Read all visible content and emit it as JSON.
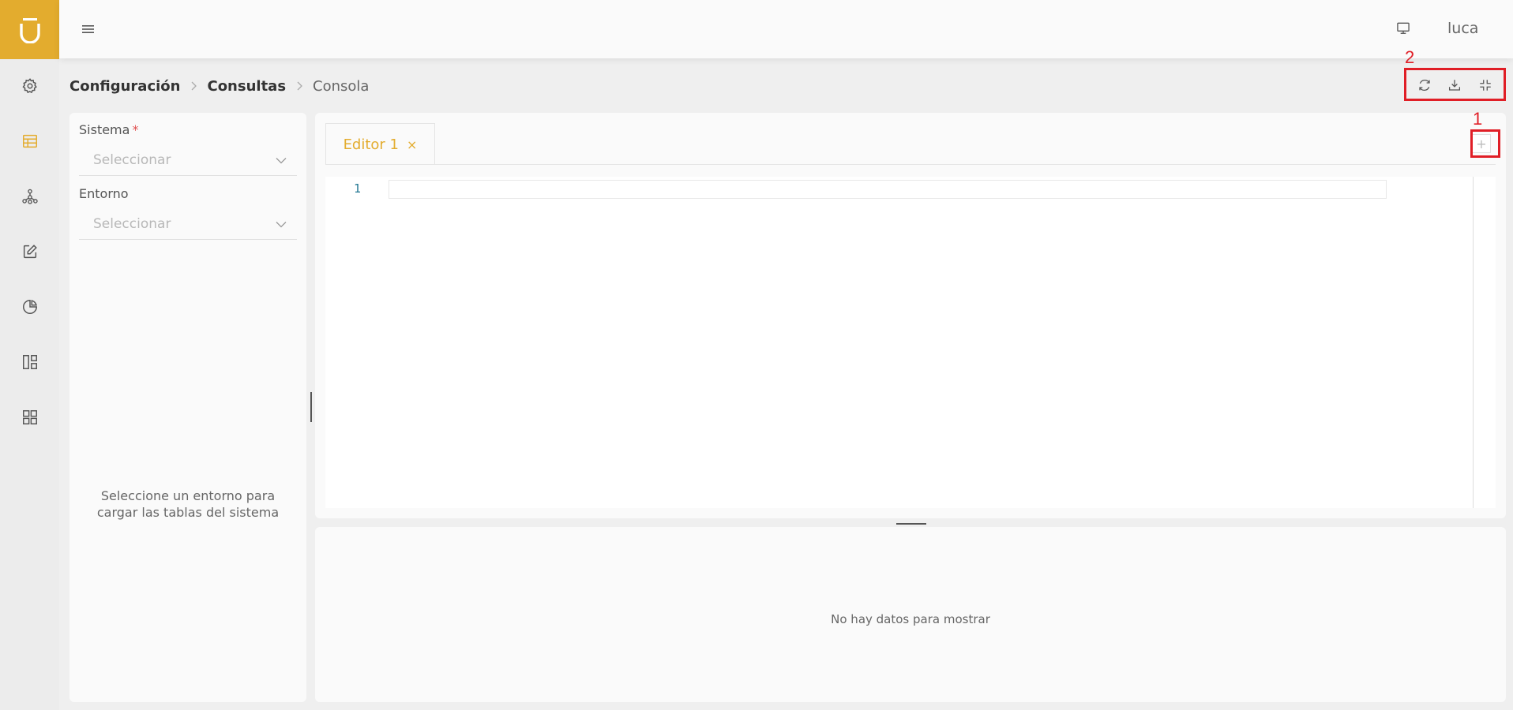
{
  "app": {
    "user": "luca"
  },
  "breadcrumb": {
    "level1": "Configuración",
    "level2": "Consultas",
    "current": "Consola"
  },
  "filters": {
    "system": {
      "label": "Sistema",
      "required_mark": "*",
      "placeholder": "Seleccionar"
    },
    "environment": {
      "label": "Entorno",
      "placeholder": "Seleccionar"
    },
    "empty_message_line1": "Seleccione un entorno para",
    "empty_message_line2": "cargar las tablas del sistema"
  },
  "editor": {
    "tabs": [
      {
        "label": "Editor 1",
        "close": "×"
      }
    ],
    "add_tab": "+",
    "line_numbers": [
      "1"
    ]
  },
  "results": {
    "empty_message": "No hay datos para mostrar"
  },
  "annotations": {
    "box1": "1",
    "box2": "2"
  },
  "colors": {
    "accent": "#e3ac2e",
    "annotation": "#e01e26"
  }
}
